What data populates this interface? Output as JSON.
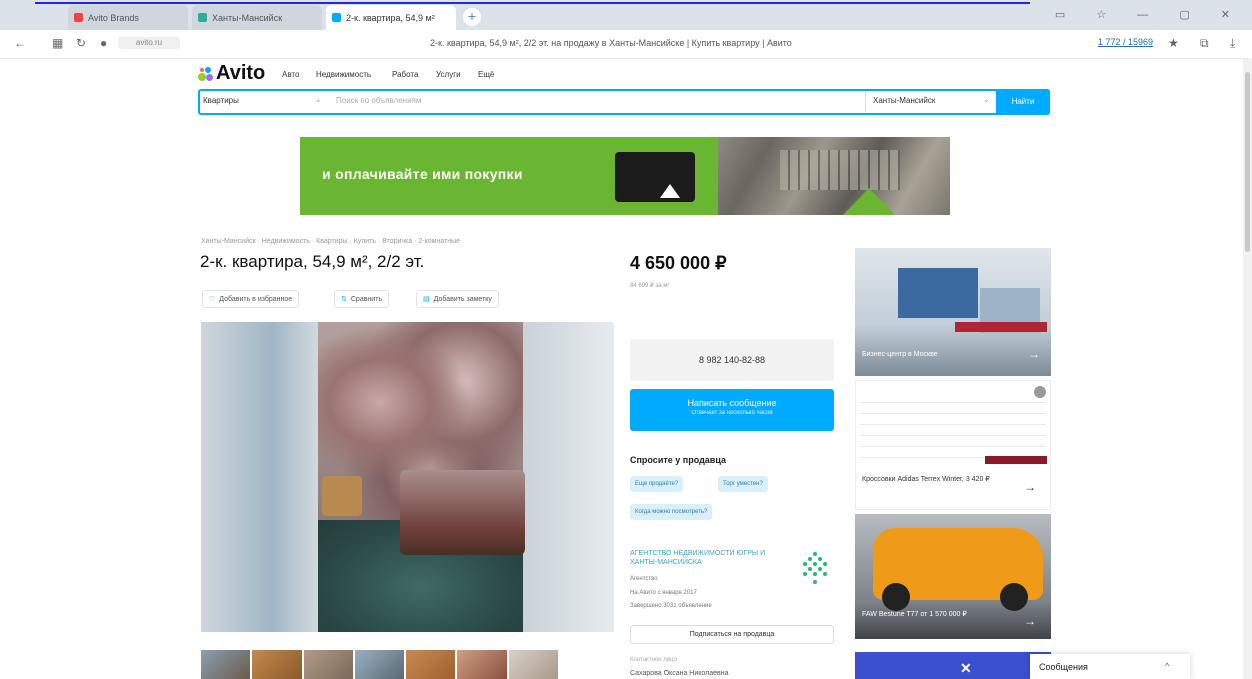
{
  "browser": {
    "tabs": [
      {
        "label": "Avito Brands"
      },
      {
        "label": "Ханты-Мансийск"
      },
      {
        "label": "2-к. квартира, 54,9 м²"
      }
    ],
    "new_tab": "+",
    "address": "avito.ru",
    "page_title": "2-к. квартира, 54,9 м², 2/2 эт. на продажу в Ханты-Мансийске | Купить квартиру | Авито",
    "zoom_label": "1 772 / 15969"
  },
  "site": {
    "logo": "Avito",
    "nav": [
      "Авто",
      "Недвижимость",
      "Работа",
      "Услуги",
      "Ещё"
    ],
    "search": {
      "category": "Квартиры",
      "placeholder": "Поиск по объявлениям",
      "city": "Ханты-Мансийск",
      "button": "Найти"
    }
  },
  "banner": {
    "text": "и оплачивайте ими покупки"
  },
  "listing": {
    "breadcrumbs": "Ханты-Мансийск · Недвижимость · Квартиры · Купить · Вторичка · 2-комнатные",
    "title": "2-к. квартира, 54,9 м², 2/2 эт.",
    "actions": [
      "Добавить в избранное",
      "Сравнить",
      "Добавить заметку"
    ],
    "price": "4 650 000 ₽",
    "price_per_m": "84 699 ₽ за м²",
    "phone": "8 982 140-82-88",
    "write_button": "Написать сообщение",
    "write_sub": "Отвечает за несколько часов",
    "ask_header": "Спросите у продавца",
    "quick_questions": [
      "Еще продаёте?",
      "Торг уместен?",
      "Когда можно посмотреть?"
    ],
    "seller": {
      "name": "АГЕНТСТВО НЕДВИЖИМОСТИ ЮГРЫ И ХАНТЫ-МАНСИЙСКА",
      "type": "Агентство",
      "since": "На Авито с января 2017",
      "completed": "Завершено 3031 объявление",
      "subscribe": "Подписаться на продавца",
      "contact_label": "Контактное лицо",
      "contact_name": "Сахарова Оксана Николаевна"
    }
  },
  "ads": [
    {
      "caption": "Бизнес-центр в Москве"
    },
    {
      "caption": "Кроссовки Adidas Terrex Winter, 3 420 ₽"
    },
    {
      "caption": "FAW Bestune T77 от 1 570 000 ₽"
    }
  ],
  "messages": {
    "label": "Сообщения"
  },
  "colors": {
    "accent": "#00aaff",
    "banner_green": "#6ab531"
  }
}
